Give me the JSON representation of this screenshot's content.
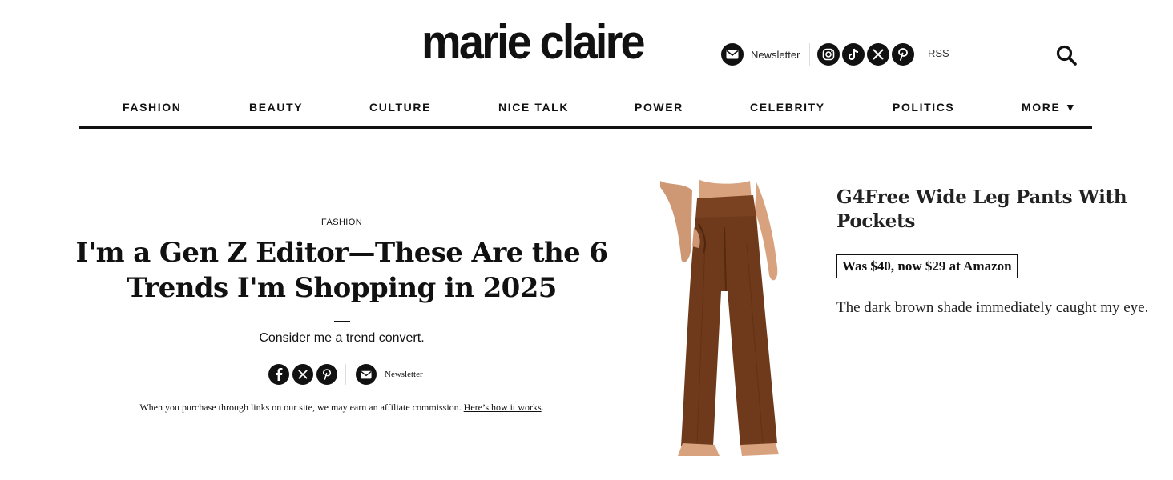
{
  "header": {
    "logo": "marie claire",
    "newsletter_label": "Newsletter",
    "social_icons": [
      "instagram-icon",
      "tiktok-icon",
      "x-icon",
      "pinterest-icon"
    ],
    "rss_label": "RSS"
  },
  "nav": {
    "items": [
      "FASHION",
      "BEAUTY",
      "CULTURE",
      "NICE TALK",
      "POWER",
      "CELEBRITY",
      "POLITICS",
      "MORE ▼"
    ]
  },
  "article": {
    "category": "FASHION",
    "headline": "I'm a Gen Z Editor—These Are the 6 Trends I'm Shopping in 2025",
    "dek": "Consider me a trend convert.",
    "share_icons": [
      "facebook-icon",
      "x-icon",
      "pinterest-icon"
    ],
    "share_newsletter_label": "Newsletter",
    "affiliate_text": "When you purchase through links on our site, we may earn an affiliate commission.",
    "affiliate_link": "Here’s how it works",
    "affiliate_end": "."
  },
  "product": {
    "title": "G4Free Wide Leg Pants With Pockets",
    "price_label": "Was $40, now $29 at Amazon",
    "description": "The dark brown shade immediately caught my eye.",
    "colors": {
      "pants": "#6e3a1b",
      "skin": "#d9a27e"
    }
  }
}
